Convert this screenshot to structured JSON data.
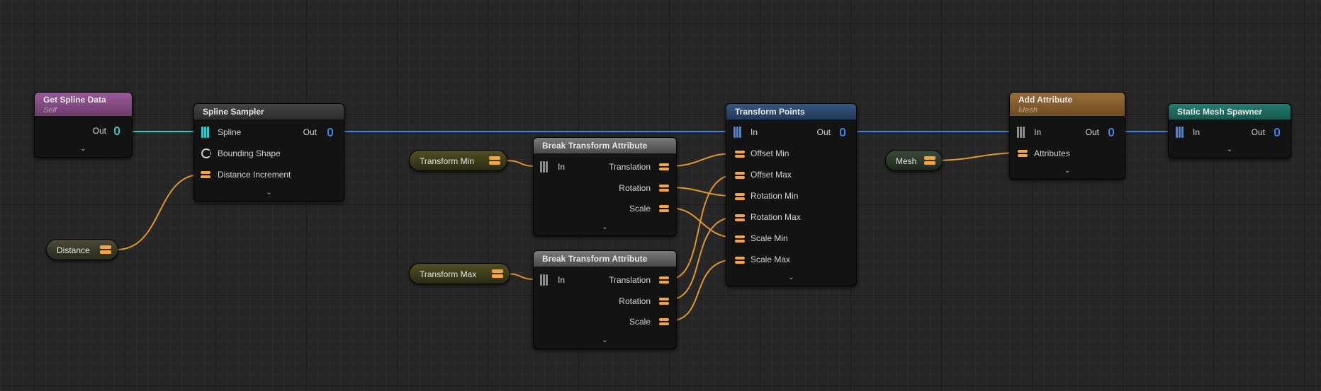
{
  "colors": {
    "background": "#262626",
    "node_body": "#131313",
    "point_data_pin": "#3e86e8",
    "spline_data_pin": "#35c9c9",
    "attribute_pin": "#f7a53a",
    "any_data_pin": "#8c8c8c"
  },
  "nodes": {
    "get_spline_data": {
      "title": "Get Spline Data",
      "subtitle": "Self",
      "header_color": "#8e4e8c",
      "out_label": "Out",
      "out_pin_icon": "spline-data-pin-icon",
      "expand_icon": "chevron-down-icon"
    },
    "spline_sampler": {
      "title": "Spline Sampler",
      "header_color": "#3b3b3b",
      "spline_label": "Spline",
      "bounding_shape_label": "Bounding Shape",
      "distance_increment_label": "Distance Increment",
      "out_label": "Out",
      "expand_icon": "chevron-down-icon"
    },
    "distance": {
      "label": "Distance",
      "color": "#3d3d2c"
    },
    "transform_min": {
      "label": "Transform Min",
      "color": "#3f3f1d"
    },
    "transform_max": {
      "label": "Transform Max",
      "color": "#3f3f1d"
    },
    "break_transform_1": {
      "title": "Break Transform Attribute",
      "header_color": "#5f5f5f",
      "in_label": "In",
      "translation_label": "Translation",
      "rotation_label": "Rotation",
      "scale_label": "Scale",
      "expand_icon": "chevron-down-icon"
    },
    "break_transform_2": {
      "title": "Break Transform Attribute",
      "header_color": "#5f5f5f",
      "in_label": "In",
      "translation_label": "Translation",
      "rotation_label": "Rotation",
      "scale_label": "Scale",
      "expand_icon": "chevron-down-icon"
    },
    "transform_points": {
      "title": "Transform Points",
      "header_color": "#2a456b",
      "in_label": "In",
      "out_label": "Out",
      "offset_min_label": "Offset Min",
      "offset_max_label": "Offset Max",
      "rotation_min_label": "Rotation Min",
      "rotation_max_label": "Rotation Max",
      "scale_min_label": "Scale Min",
      "scale_max_label": "Scale Max",
      "expand_icon": "chevron-down-icon"
    },
    "mesh": {
      "label": "Mesh",
      "color": "#2e3a2d"
    },
    "add_attribute": {
      "title": "Add Attribute",
      "subtitle": "Mesh",
      "header_color": "#8a6233",
      "in_label": "In",
      "out_label": "Out",
      "attributes_label": "Attributes",
      "expand_icon": "chevron-down-icon"
    },
    "static_mesh_spawner": {
      "title": "Static Mesh Spawner",
      "header_color": "#1f6f64",
      "in_label": "In",
      "out_label": "Out",
      "expand_icon": "chevron-down-icon"
    }
  }
}
